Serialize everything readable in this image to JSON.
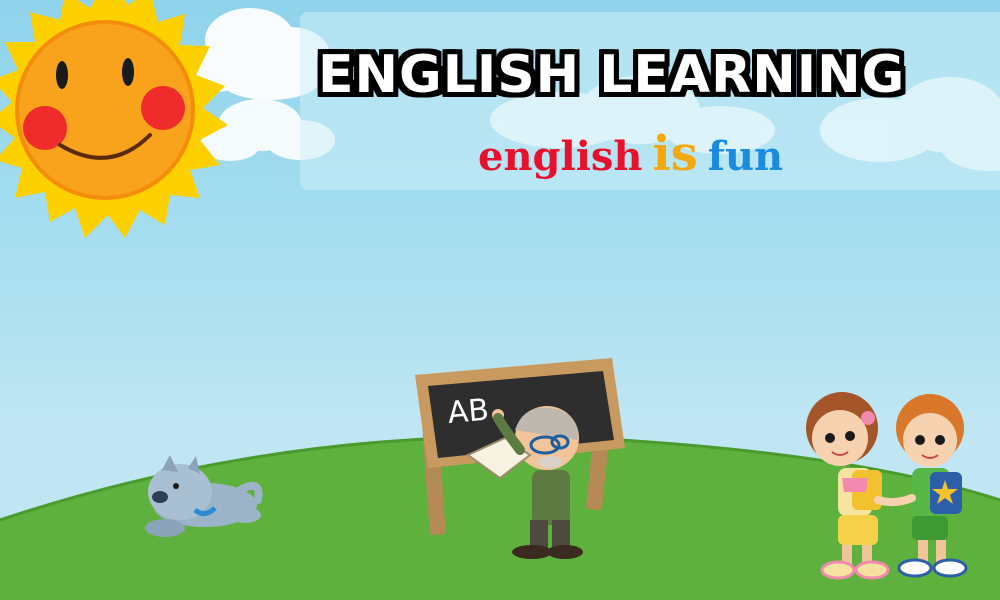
{
  "header": {
    "title": "ENGLISH LEARNING",
    "subtitle_words": [
      {
        "text": "english",
        "color": "#e8112d"
      },
      {
        "text": "is",
        "color": "#f3a80c"
      },
      {
        "text": "fun",
        "color": "#1b8be0"
      }
    ]
  },
  "blackboard": {
    "text": "AB"
  },
  "colors": {
    "sky_top": "#8fd3ec",
    "grass": "#5fb13d",
    "sun_face": "#f9a21b",
    "sun_rays": "#fdd000",
    "cheeks": "#ef2b2b",
    "chalkboard": "#2e2e2e",
    "frame": "#b58a55"
  },
  "icons": [
    "sun-icon",
    "cloud-icon",
    "dog-icon",
    "teacher-icon",
    "kids-icon"
  ]
}
